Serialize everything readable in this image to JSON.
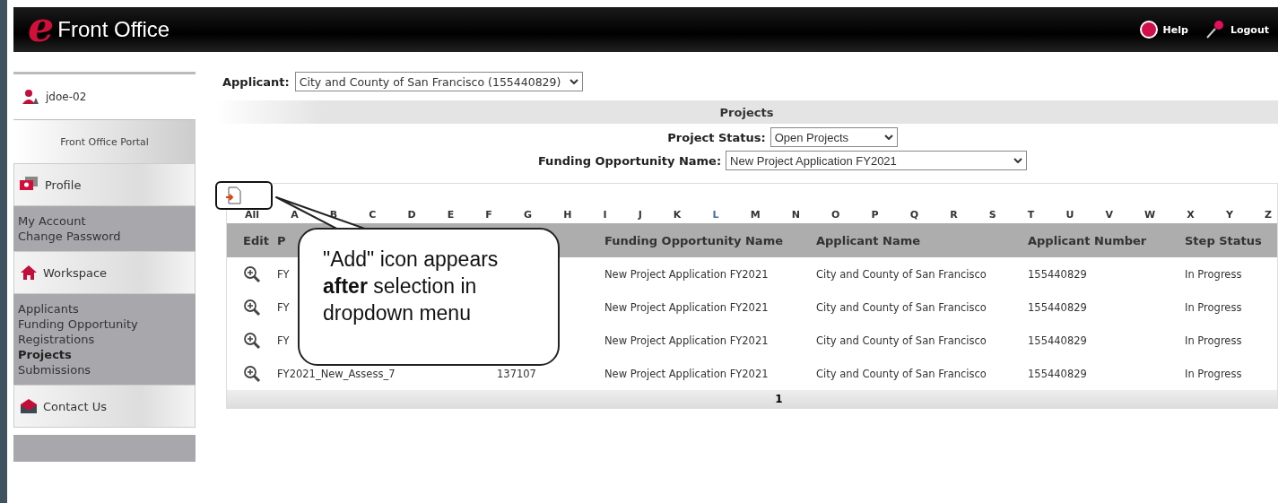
{
  "header": {
    "logo_letter": "e",
    "title": "Front Office",
    "links": [
      {
        "label": "Help",
        "kind": "help"
      },
      {
        "label": "Logout",
        "kind": "logout"
      }
    ]
  },
  "sidebar": {
    "user": "jdoe-02",
    "portal": "Front Office Portal",
    "sections": [
      {
        "title": "Profile",
        "kind": "profile",
        "items": [
          {
            "label": "My Account",
            "selected": false
          },
          {
            "label": "Change Password",
            "selected": false
          }
        ]
      },
      {
        "title": "Workspace",
        "kind": "home",
        "items": [
          {
            "label": "Applicants",
            "selected": false
          },
          {
            "label": "Funding Opportunity Registrations",
            "selected": false
          },
          {
            "label": "Projects",
            "selected": true
          },
          {
            "label": "Submissions",
            "selected": false
          }
        ]
      },
      {
        "title": "Contact Us",
        "kind": "mail"
      }
    ]
  },
  "applicant": {
    "label": "Applicant:",
    "value": "City and County of San Francisco (155440829)"
  },
  "projects": {
    "title": "Projects",
    "filters": [
      {
        "label": "Project Status:",
        "value": "Open Projects"
      },
      {
        "label": "Funding Opportunity Name:",
        "value": "New Project Application FY2021"
      }
    ],
    "letters": [
      {
        "label": "All",
        "selected": false
      },
      {
        "label": "A",
        "selected": false
      },
      {
        "label": "B",
        "selected": false
      },
      {
        "label": "C",
        "selected": false
      },
      {
        "label": "D",
        "selected": false
      },
      {
        "label": "E",
        "selected": false
      },
      {
        "label": "F",
        "selected": false
      },
      {
        "label": "G",
        "selected": false
      },
      {
        "label": "H",
        "selected": false
      },
      {
        "label": "I",
        "selected": false
      },
      {
        "label": "J",
        "selected": false
      },
      {
        "label": "K",
        "selected": false
      },
      {
        "label": "L",
        "selected": true
      },
      {
        "label": "M",
        "selected": false
      },
      {
        "label": "N",
        "selected": false
      },
      {
        "label": "O",
        "selected": false
      },
      {
        "label": "P",
        "selected": false
      },
      {
        "label": "Q",
        "selected": false
      },
      {
        "label": "R",
        "selected": false
      },
      {
        "label": "S",
        "selected": false
      },
      {
        "label": "T",
        "selected": false
      },
      {
        "label": "U",
        "selected": false
      },
      {
        "label": "V",
        "selected": false
      },
      {
        "label": "W",
        "selected": false
      },
      {
        "label": "X",
        "selected": false
      },
      {
        "label": "Y",
        "selected": false
      },
      {
        "label": "Z",
        "selected": false
      }
    ],
    "columns": [
      "Edit",
      "P",
      "",
      "Funding Opportunity Name",
      "Applicant Name",
      "Applicant Number",
      "Step Status"
    ],
    "rows": [
      {
        "project": "FY",
        "number": "",
        "funding": "New Project Application FY2021",
        "applicant": "City and County of San Francisco",
        "applicant_number": "155440829",
        "status": "In Progress"
      },
      {
        "project": "FY",
        "number": "",
        "funding": "New Project Application FY2021",
        "applicant": "City and County of San Francisco",
        "applicant_number": "155440829",
        "status": "In Progress"
      },
      {
        "project": "FY",
        "number": "",
        "funding": "New Project Application FY2021",
        "applicant": "City and County of San Francisco",
        "applicant_number": "155440829",
        "status": "In Progress"
      },
      {
        "project": "FY2021_New_Assess_7",
        "number": "137107",
        "funding": "New Project Application FY2021",
        "applicant": "City and County of San Francisco",
        "applicant_number": "155440829",
        "status": "In Progress"
      }
    ],
    "pages": [
      "1"
    ]
  },
  "callout": "\"Add\" icon appears **after** selection in dropdown menu"
}
